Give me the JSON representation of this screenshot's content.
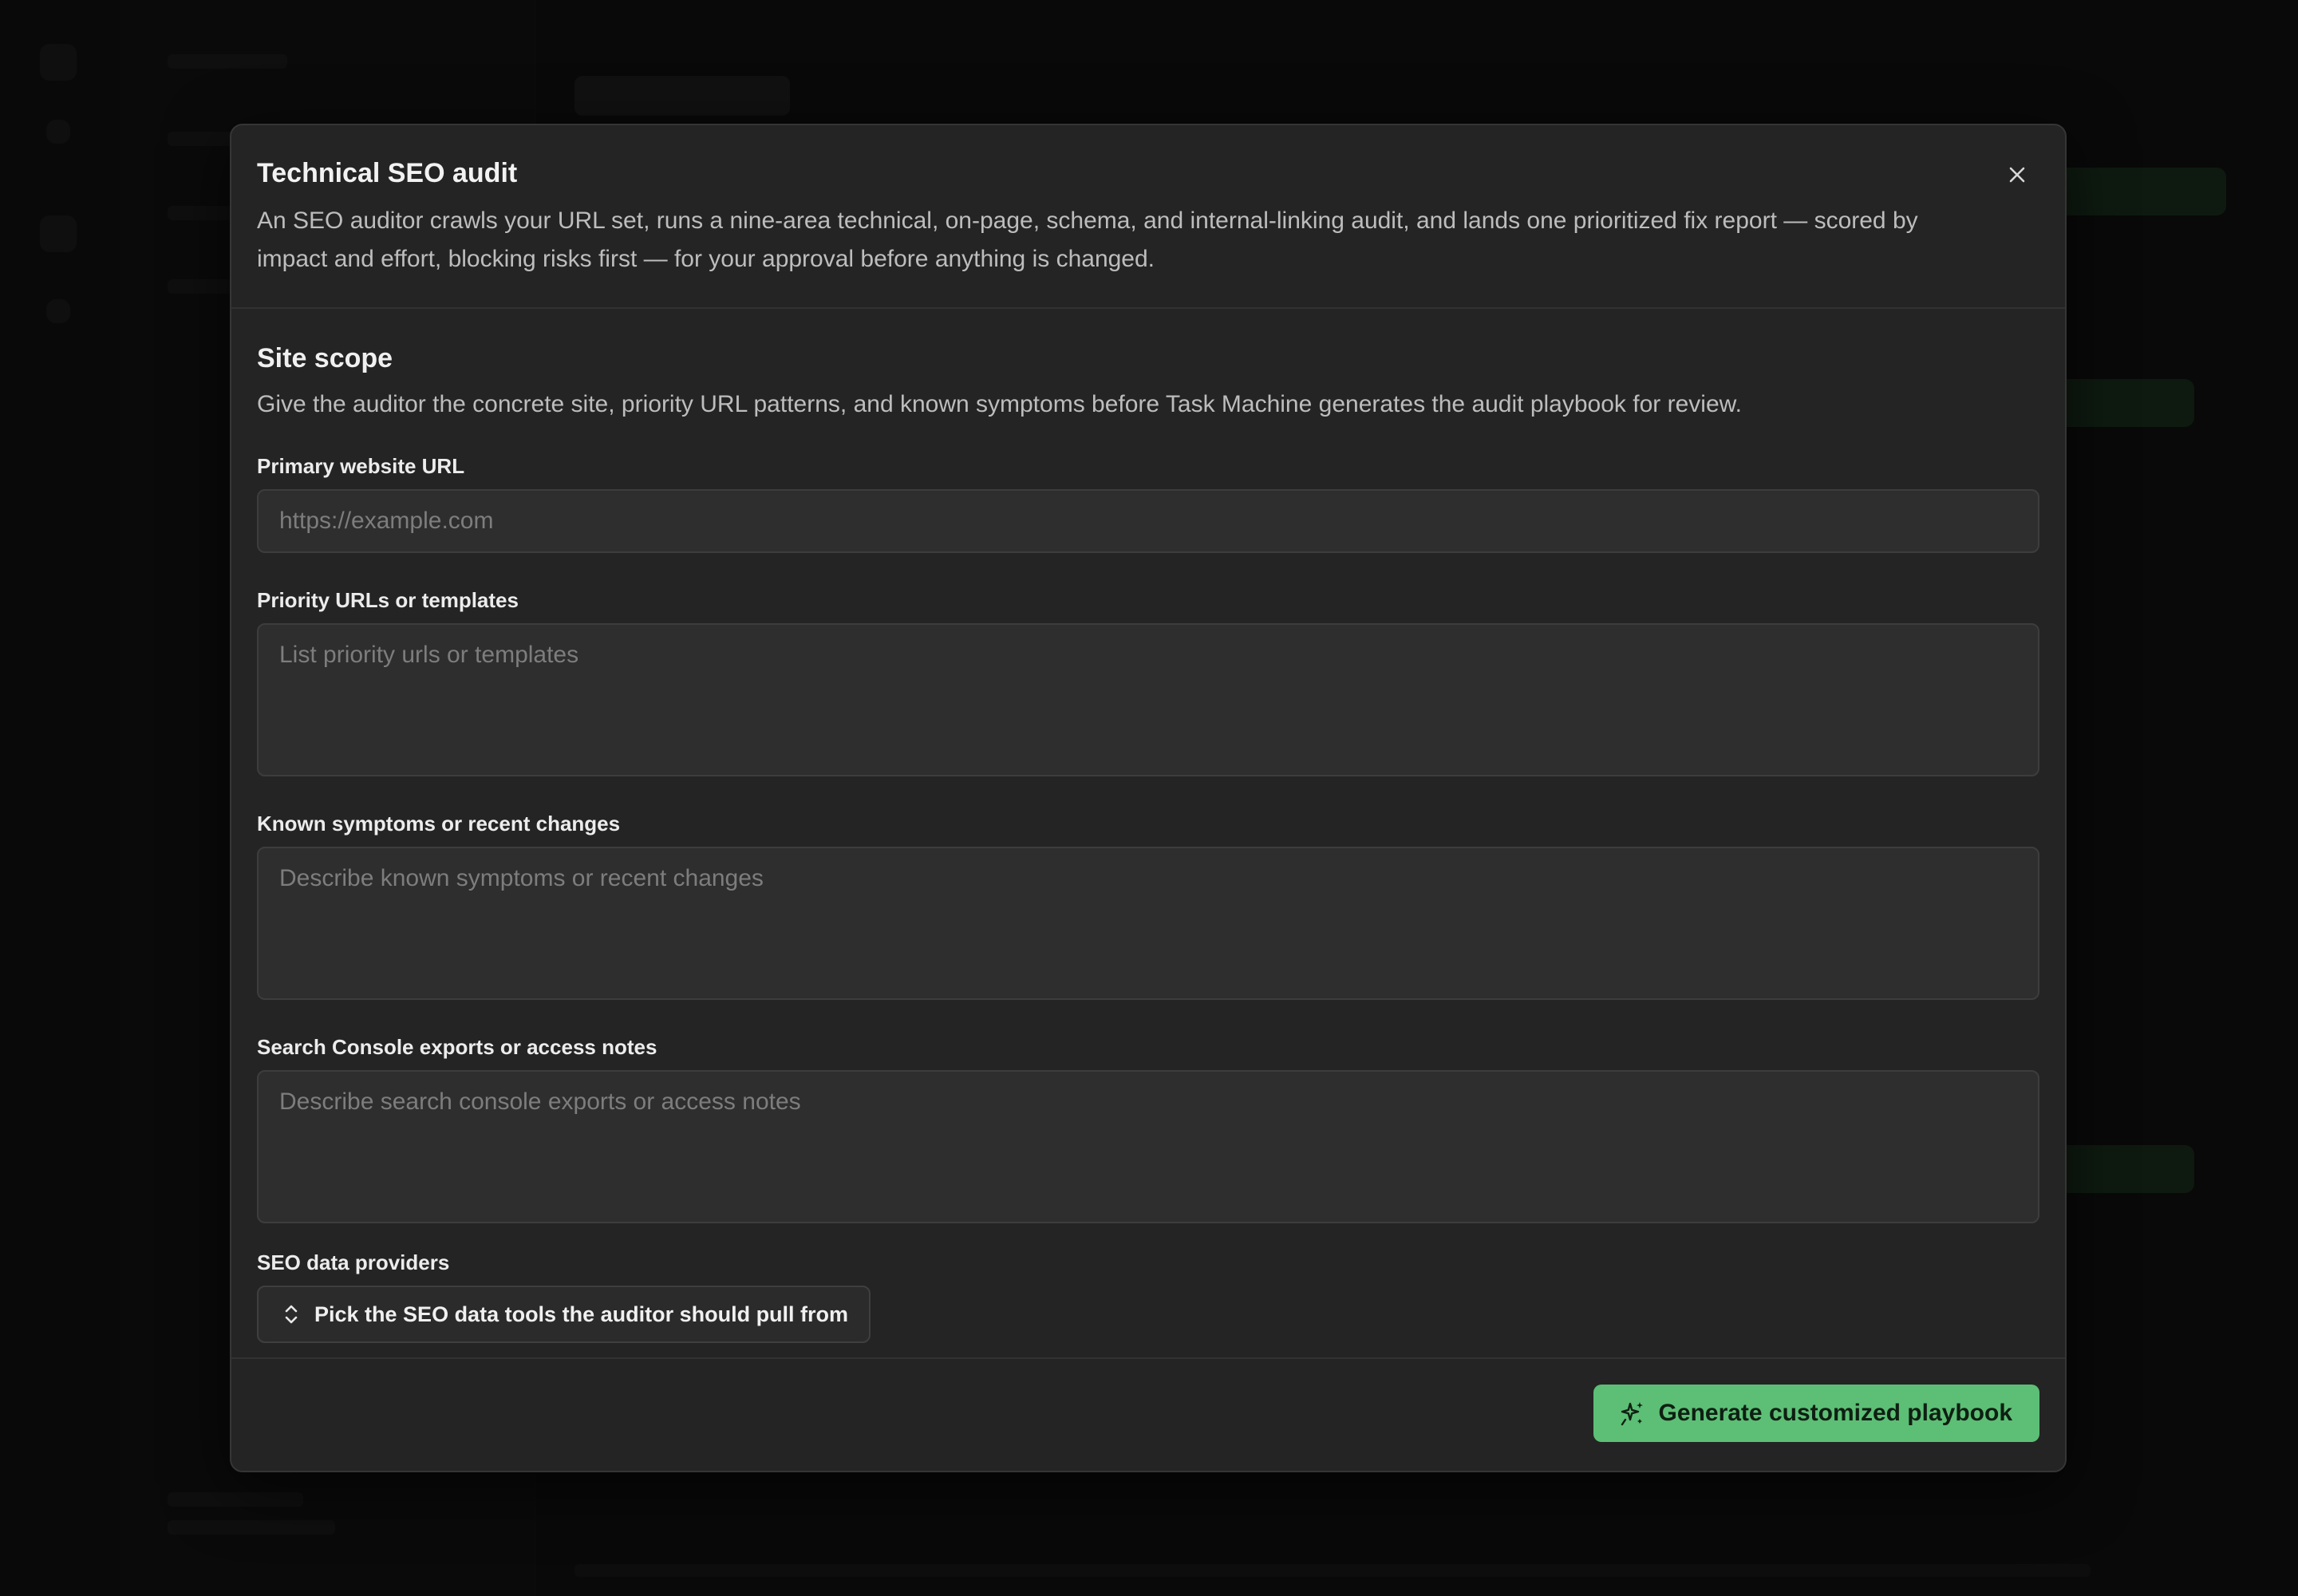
{
  "modal": {
    "title": "Technical SEO audit",
    "description": "An SEO auditor crawls your URL set, runs a nine-area technical, on-page, schema, and internal-linking audit, and lands one prioritized fix report — scored by impact and effort, blocking risks first — for your approval before anything is changed.",
    "close_icon": "close-icon"
  },
  "section": {
    "title": "Site scope",
    "description": "Give the auditor the concrete site, priority URL patterns, and known symptoms before Task Machine generates the audit playbook for review."
  },
  "fields": {
    "website_url": {
      "label": "Primary website URL",
      "placeholder": "https://example.com",
      "value": ""
    },
    "priority_urls": {
      "label": "Priority URLs or templates",
      "placeholder": "List priority urls or templates",
      "value": ""
    },
    "symptoms": {
      "label": "Known symptoms or recent changes",
      "placeholder": "Describe known symptoms or recent changes",
      "value": ""
    },
    "search_console": {
      "label": "Search Console exports or access notes",
      "placeholder": "Describe search console exports or access notes",
      "value": ""
    }
  },
  "providers": {
    "label": "SEO data providers",
    "picker_label": "Pick the SEO data tools the auditor should pull from",
    "picker_icon": "chevron-up-down-icon"
  },
  "footer": {
    "generate_label": "Generate customized playbook",
    "generate_icon": "sparkles-icon"
  },
  "colors": {
    "accent": "#5cbf75",
    "modal_bg": "#242424",
    "backdrop": "#0f0f0f"
  }
}
